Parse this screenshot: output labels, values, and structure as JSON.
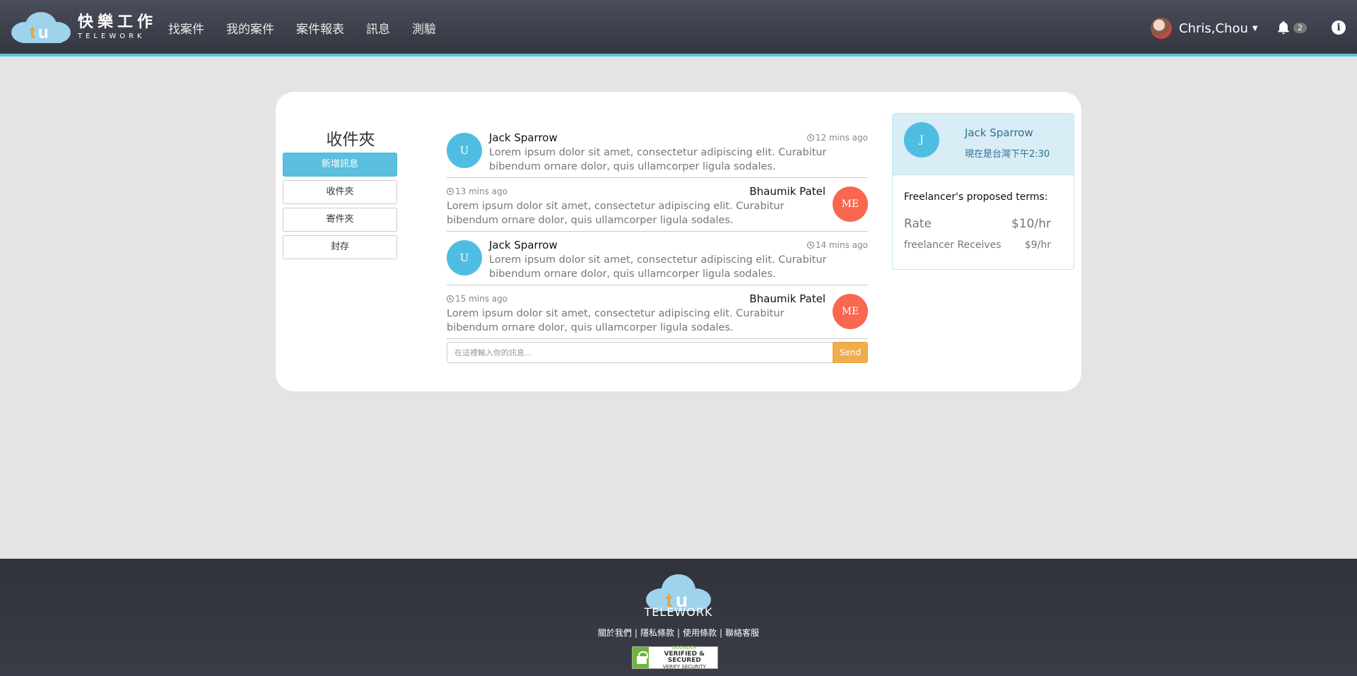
{
  "brand": {
    "name_zh": "快樂工作",
    "name_en": "TELEWORK"
  },
  "nav": {
    "items": [
      "找案件",
      "我的案件",
      "案件報表",
      "訊息",
      "測驗"
    ]
  },
  "user": {
    "name": "Chris,Chou",
    "notifications": "2"
  },
  "sidebar": {
    "title": "收件夾",
    "buttons": [
      "新增訊息",
      "收件夾",
      "寄件夾",
      "封存"
    ]
  },
  "messages": [
    {
      "direction": "in",
      "avatar": "U",
      "name": "Jack Sparrow",
      "time": "12 mins ago",
      "text": "Lorem ipsum dolor sit amet, consectetur adipiscing elit. Curabitur bibendum ornare dolor, quis ullamcorper ligula sodales."
    },
    {
      "direction": "out",
      "avatar": "ME",
      "name": "Bhaumik Patel",
      "time": "13 mins ago",
      "text": "Lorem ipsum dolor sit amet, consectetur adipiscing elit. Curabitur bibendum ornare dolor, quis ullamcorper ligula sodales."
    },
    {
      "direction": "in",
      "avatar": "U",
      "name": "Jack Sparrow",
      "time": "14 mins ago",
      "text": "Lorem ipsum dolor sit amet, consectetur adipiscing elit. Curabitur bibendum ornare dolor, quis ullamcorper ligula sodales."
    },
    {
      "direction": "out",
      "avatar": "ME",
      "name": "Bhaumik Patel",
      "time": "15 mins ago",
      "text": "Lorem ipsum dolor sit amet, consectetur adipiscing elit. Curabitur bibendum ornare dolor, quis ullamcorper ligula sodales."
    }
  ],
  "composer": {
    "placeholder": "在這裡輸入你的訊息...",
    "send_label": "Send"
  },
  "contact": {
    "avatar": "J",
    "name": "Jack Sparrow",
    "local_time": "現在是台灣下午2:30",
    "terms_title": "Freelancer's proposed terms:",
    "rate_label": "Rate",
    "rate_value": "$10/hr",
    "receives_label": "freelancer Receives",
    "receives_value": "$9/hr"
  },
  "footer": {
    "brand": "TELEWORK",
    "links": [
      "關於我們",
      "隱私條款",
      "使用條款",
      "聯絡客服"
    ],
    "seal_top": "GODADDY",
    "seal_main": "VERIFIED & SECURED",
    "seal_bottom": "VERIFY SECURITY"
  },
  "colors": {
    "accent": "#52c6d8",
    "primary_button": "#5bc0de",
    "send_button": "#f0ad4e",
    "avatar_in": "#4fbde2",
    "avatar_out": "#f9674f",
    "logo_orange": "#f0a030"
  },
  "icons": [
    "cloud-logo-icon",
    "bell-icon",
    "info-icon",
    "clock-icon",
    "caret-down-icon",
    "lock-icon"
  ]
}
